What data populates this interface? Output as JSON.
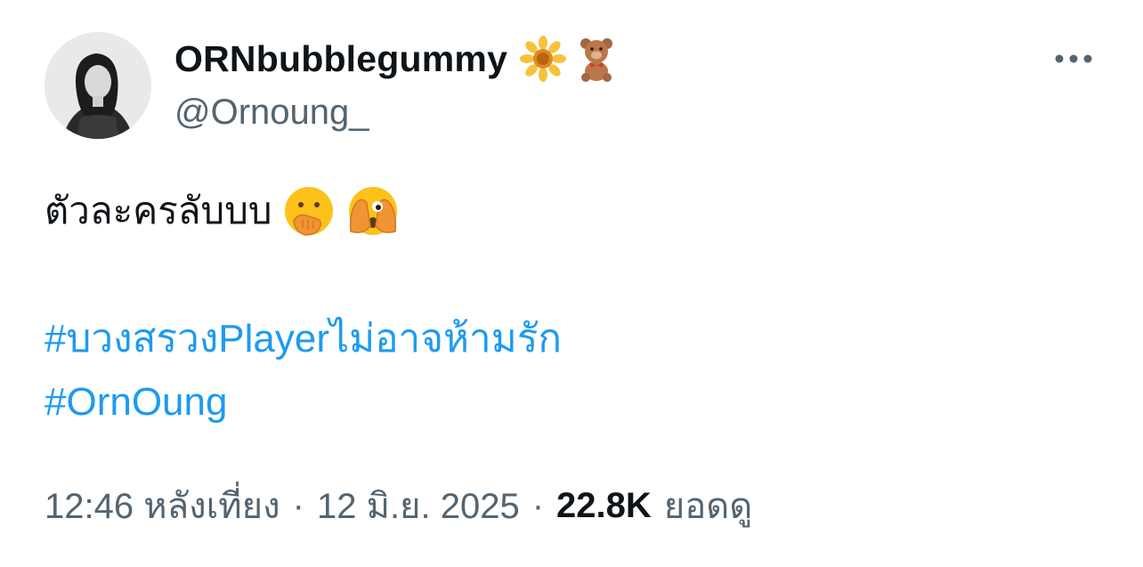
{
  "author": {
    "display_name": "ORNbubblegummy",
    "name_emojis": [
      "sunflower-icon",
      "teddy-bear-icon"
    ],
    "handle": "@Ornoung_"
  },
  "tweet": {
    "text": "ตัวละครลับบบ",
    "text_emojis": [
      "hand-over-mouth-icon",
      "peeking-eye-icon"
    ],
    "hashtags": [
      "#บวงสรวงPlayerไม่อาจห้ามรัก",
      "#OrnOung"
    ]
  },
  "meta": {
    "time": "12:46 หลังเที่ยง",
    "separator": "·",
    "date": "12 มิ.ย. 2025",
    "views_count": "22.8K",
    "views_label": "ยอดดู"
  },
  "colors": {
    "text": "#0f1419",
    "secondary": "#536471",
    "link": "#1d9bf0",
    "background": "#ffffff"
  }
}
